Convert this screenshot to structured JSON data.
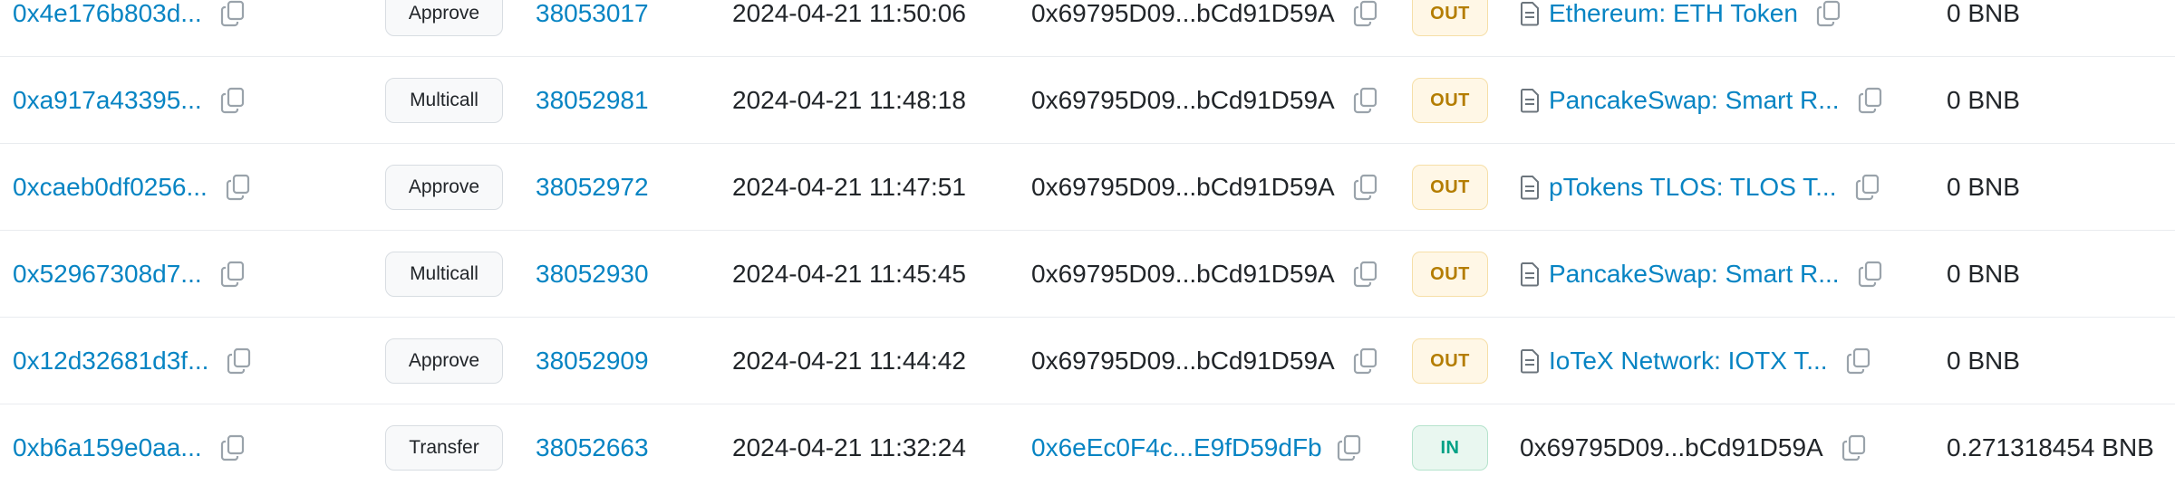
{
  "colors": {
    "link": "#0784c3",
    "text": "#212529",
    "out_badge_text": "#b47d00",
    "out_badge_bg": "#fff7e6",
    "in_badge_text": "#00a186",
    "in_badge_bg": "#e9f7f0"
  },
  "icons": {
    "copy": "copy-icon",
    "contract": "contract-file-icon"
  },
  "rows": [
    {
      "hash": "0x4e176b803d...",
      "method": "Approve",
      "block": "38053017",
      "age": "2024-04-21 11:50:06",
      "from": "0x69795D09...bCd91D59A",
      "from_is_link": false,
      "direction": "OUT",
      "to": "Ethereum: ETH Token",
      "to_is_contract": true,
      "to_is_link": true,
      "value": "0 BNB"
    },
    {
      "hash": "0xa917a43395...",
      "method": "Multicall",
      "block": "38052981",
      "age": "2024-04-21 11:48:18",
      "from": "0x69795D09...bCd91D59A",
      "from_is_link": false,
      "direction": "OUT",
      "to": "PancakeSwap: Smart R...",
      "to_is_contract": true,
      "to_is_link": true,
      "value": "0 BNB"
    },
    {
      "hash": "0xcaeb0df0256...",
      "method": "Approve",
      "block": "38052972",
      "age": "2024-04-21 11:47:51",
      "from": "0x69795D09...bCd91D59A",
      "from_is_link": false,
      "direction": "OUT",
      "to": "pTokens TLOS: TLOS T...",
      "to_is_contract": true,
      "to_is_link": true,
      "value": "0 BNB"
    },
    {
      "hash": "0x52967308d7...",
      "method": "Multicall",
      "block": "38052930",
      "age": "2024-04-21 11:45:45",
      "from": "0x69795D09...bCd91D59A",
      "from_is_link": false,
      "direction": "OUT",
      "to": "PancakeSwap: Smart R...",
      "to_is_contract": true,
      "to_is_link": true,
      "value": "0 BNB"
    },
    {
      "hash": "0x12d32681d3f...",
      "method": "Approve",
      "block": "38052909",
      "age": "2024-04-21 11:44:42",
      "from": "0x69795D09...bCd91D59A",
      "from_is_link": false,
      "direction": "OUT",
      "to": "IoTeX Network: IOTX T...",
      "to_is_contract": true,
      "to_is_link": true,
      "value": "0 BNB"
    },
    {
      "hash": "0xb6a159e0aa...",
      "method": "Transfer",
      "block": "38052663",
      "age": "2024-04-21 11:32:24",
      "from": "0x6eEc0F4c...E9fD59dFb",
      "from_is_link": true,
      "direction": "IN",
      "to": "0x69795D09...bCd91D59A",
      "to_is_contract": false,
      "to_is_link": false,
      "value": "0.271318454 BNB"
    }
  ]
}
